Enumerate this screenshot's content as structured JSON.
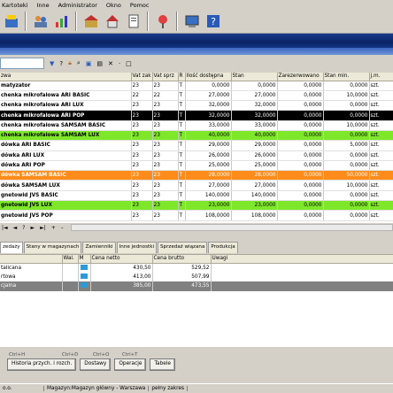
{
  "menu": [
    "Kartoteki",
    "Inne",
    "Administrator",
    "Okno",
    "Pomoc"
  ],
  "toolbar_icons": [
    "cash-register-icon",
    "people-icon",
    "chart-icon",
    "warehouse-icon",
    "home-icon",
    "document-icon",
    "location-icon",
    "computer-icon",
    "help-icon"
  ],
  "filter": {
    "value": "",
    "icons": [
      "filter-icon",
      "question-icon",
      "lock-icon",
      "search-icon",
      "image-icon",
      "chart-small-icon",
      "close-icon",
      "minus-icon",
      "square-icon"
    ]
  },
  "grid": {
    "columns": [
      "zwa",
      "Vat zak",
      "Vat sprz",
      "R",
      "Ilość dostępna",
      "Stan",
      "Zarezerwowano",
      "Stan min.",
      "j.m."
    ],
    "rows": [
      [
        "matyzator",
        "23",
        "23",
        "T",
        "0,0000",
        "0,0000",
        "0,0000",
        "0,0000",
        "szt."
      ],
      [
        "chenka mikrofalowa ARI BASIC",
        "22",
        "22",
        "T",
        "27,0000",
        "27,0000",
        "0,0000",
        "10,0000",
        "szt."
      ],
      [
        "chenka mikrofalowa ARI LUX",
        "23",
        "23",
        "T",
        "32,0000",
        "32,0000",
        "0,0000",
        "0,0000",
        "szt."
      ],
      [
        "chenka mikrofalowa ARI POP",
        "23",
        "23",
        "T",
        "32,0000",
        "32,0000",
        "0,0000",
        "0,0000",
        "szt."
      ],
      [
        "chenka mikrofalowa SAMSAM BASIC",
        "23",
        "23",
        "T",
        "33,0000",
        "33,0000",
        "0,0000",
        "10,0000",
        "szt."
      ],
      [
        "chenka mikrofalowa SAMSAM LUX",
        "23",
        "23",
        "T",
        "40,0000",
        "40,0000",
        "0,0000",
        "0,0000",
        "szt."
      ],
      [
        "dówka ARI BASIC",
        "23",
        "23",
        "T",
        "29,0000",
        "29,0000",
        "0,0000",
        "5,0000",
        "szt."
      ],
      [
        "dówka ARI LUX",
        "23",
        "23",
        "T",
        "26,0000",
        "26,0000",
        "0,0000",
        "0,0000",
        "szt."
      ],
      [
        "dówka ARI POP",
        "23",
        "23",
        "T",
        "25,0000",
        "25,0000",
        "0,0000",
        "0,0000",
        "szt."
      ],
      [
        "dówka SAMSAM BASIC",
        "23",
        "23",
        "T",
        "28,0000",
        "28,0000",
        "0,0000",
        "50,0000",
        "szt."
      ],
      [
        "dówka SAMSAM LUX",
        "23",
        "23",
        "T",
        "27,0000",
        "27,0000",
        "0,0000",
        "10,0000",
        "szt."
      ],
      [
        "gnetowid JVS BASIC",
        "23",
        "23",
        "T",
        "140,0000",
        "140,0000",
        "0,0000",
        "0,0000",
        "szt."
      ],
      [
        "gnetowid JVS LUX",
        "23",
        "23",
        "T",
        "23,0000",
        "23,0000",
        "0,0000",
        "0,0000",
        "szt."
      ],
      [
        "gnetowid JVS POP",
        "23",
        "23",
        "T",
        "108,0000",
        "108,0000",
        "0,0000",
        "0,0000",
        "szt."
      ]
    ],
    "row_styles": [
      "",
      "",
      "",
      "sel",
      "",
      "green",
      "",
      "",
      "",
      "orange",
      "",
      "",
      "green",
      ""
    ]
  },
  "nav": [
    "|◄",
    "◄",
    "?",
    "►",
    "►|",
    "+",
    "–"
  ],
  "tabs": [
    "zedaży",
    "Stany w magazynach",
    "Zamienniki",
    "Inne jednostki",
    "Sprzedaż wiązana",
    "Produkcja"
  ],
  "prices": {
    "columns": [
      "",
      "Wal.",
      "M",
      "Cena netto",
      "Cena brutto",
      "Uwagi"
    ],
    "rows": [
      [
        "talicana",
        "",
        "",
        "430,50",
        "529,52",
        ""
      ],
      [
        "rtowa",
        "",
        "",
        "413,00",
        "507,99",
        ""
      ],
      [
        "cjalna",
        "",
        "",
        "385,00",
        "473,55",
        ""
      ]
    ]
  },
  "hotkeys": [
    "Ctrl+H",
    "Ctrl+D",
    "Ctrl+O",
    "Ctrl+T"
  ],
  "buttons": [
    "Historia przych. i rozch.",
    "Dostawy",
    "Operacje",
    "Tabele"
  ],
  "status": [
    "o.o.",
    "Magazyn:Magazyn główny - Warszawa",
    "pełny zakres"
  ]
}
